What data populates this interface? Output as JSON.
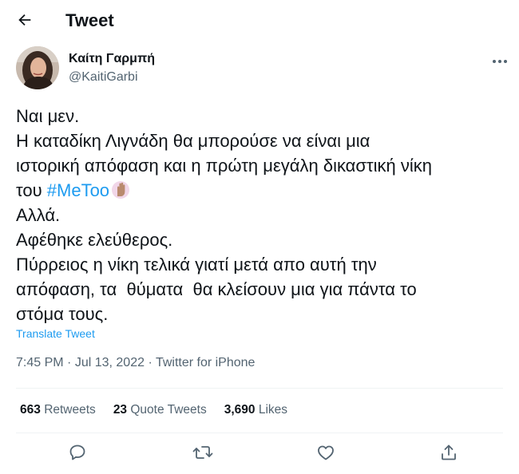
{
  "header": {
    "title": "Tweet",
    "back_icon": "arrow-left-icon"
  },
  "author": {
    "name": "Καίτη Γαρμπή",
    "handle": "@KaitiGarbi"
  },
  "tweet": {
    "lines": [
      "Ναι μεν.",
      "Η καταδίκη Λιγνάδη θα μπορούσε να είναι μια",
      "ιστορική απόφαση και η πρώτη μεγάλη δικαστική νίκη"
    ],
    "line4_prefix": "του ",
    "hashtag": "#MeToo",
    "hashtag_emoji": "raised-hand-emoji",
    "lines_after": [
      "Αλλά.",
      "Αφέθηκε ελεύθερος.",
      "Πύρρειος η νίκη τελικά γιατί μετά απο αυτή την",
      "απόφαση, τα  θύματα  θα κλείσουν μια για πάντα το",
      "στόμα τους."
    ],
    "translate_label": "Translate Tweet"
  },
  "meta": {
    "time": "7:45 PM",
    "sep1": " · ",
    "date": "Jul 13, 2022",
    "sep2": " · ",
    "source": "Twitter for iPhone"
  },
  "stats": {
    "retweets_count": "663",
    "retweets_label": "Retweets",
    "quotes_count": "23",
    "quotes_label": "Quote Tweets",
    "likes_count": "3,690",
    "likes_label": "Likes"
  },
  "actions": [
    "reply-icon",
    "retweet-icon",
    "like-icon",
    "share-icon"
  ],
  "colors": {
    "accent": "#1d9bf0",
    "text": "#0f1419",
    "secondary": "#536471",
    "divider": "#eff3f4"
  }
}
